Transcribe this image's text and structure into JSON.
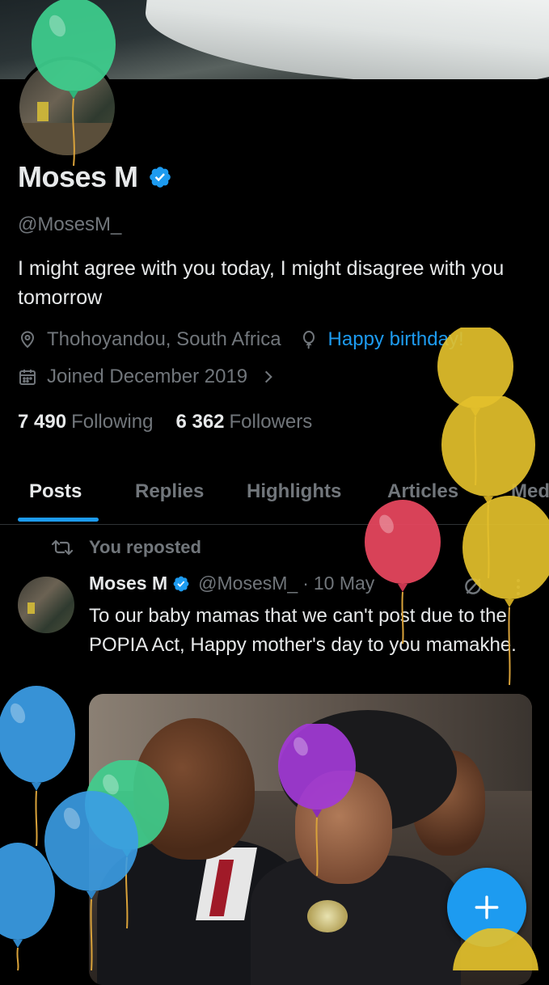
{
  "profile": {
    "display_name": "Moses M",
    "handle": "@MosesM_",
    "bio": "I might agree with you today, I might disagree with you tomorrow",
    "location": "Thohoyandou, South Africa",
    "birthday_text": "Happy birthday!",
    "joined": "Joined December 2019",
    "following_count": "7 490",
    "following_label": "Following",
    "followers_count": "6 362",
    "followers_label": "Followers",
    "verified": true
  },
  "tabs": [
    {
      "label": "Posts",
      "active": true
    },
    {
      "label": "Replies",
      "active": false
    },
    {
      "label": "Highlights",
      "active": false
    },
    {
      "label": "Articles",
      "active": false
    },
    {
      "label": "Media",
      "active": false
    }
  ],
  "post": {
    "repost_label": "You reposted",
    "author_name": "Moses M",
    "author_handle": "@MosesM_",
    "separator": "·",
    "date": "10 May",
    "text": "To our baby mamas that we can't post due to the POPIA Act, Happy mother's day to you mamakhe."
  },
  "fab_label": "+",
  "colors": {
    "accent": "#1d9bf0",
    "background": "#000000",
    "muted": "#71767b",
    "text": "#e7e9ea"
  },
  "icons": [
    "location-icon",
    "balloon-icon",
    "calendar-icon",
    "chevron-right-icon",
    "verified-icon",
    "repost-icon",
    "grok-icon",
    "more-icon",
    "plus-icon"
  ]
}
